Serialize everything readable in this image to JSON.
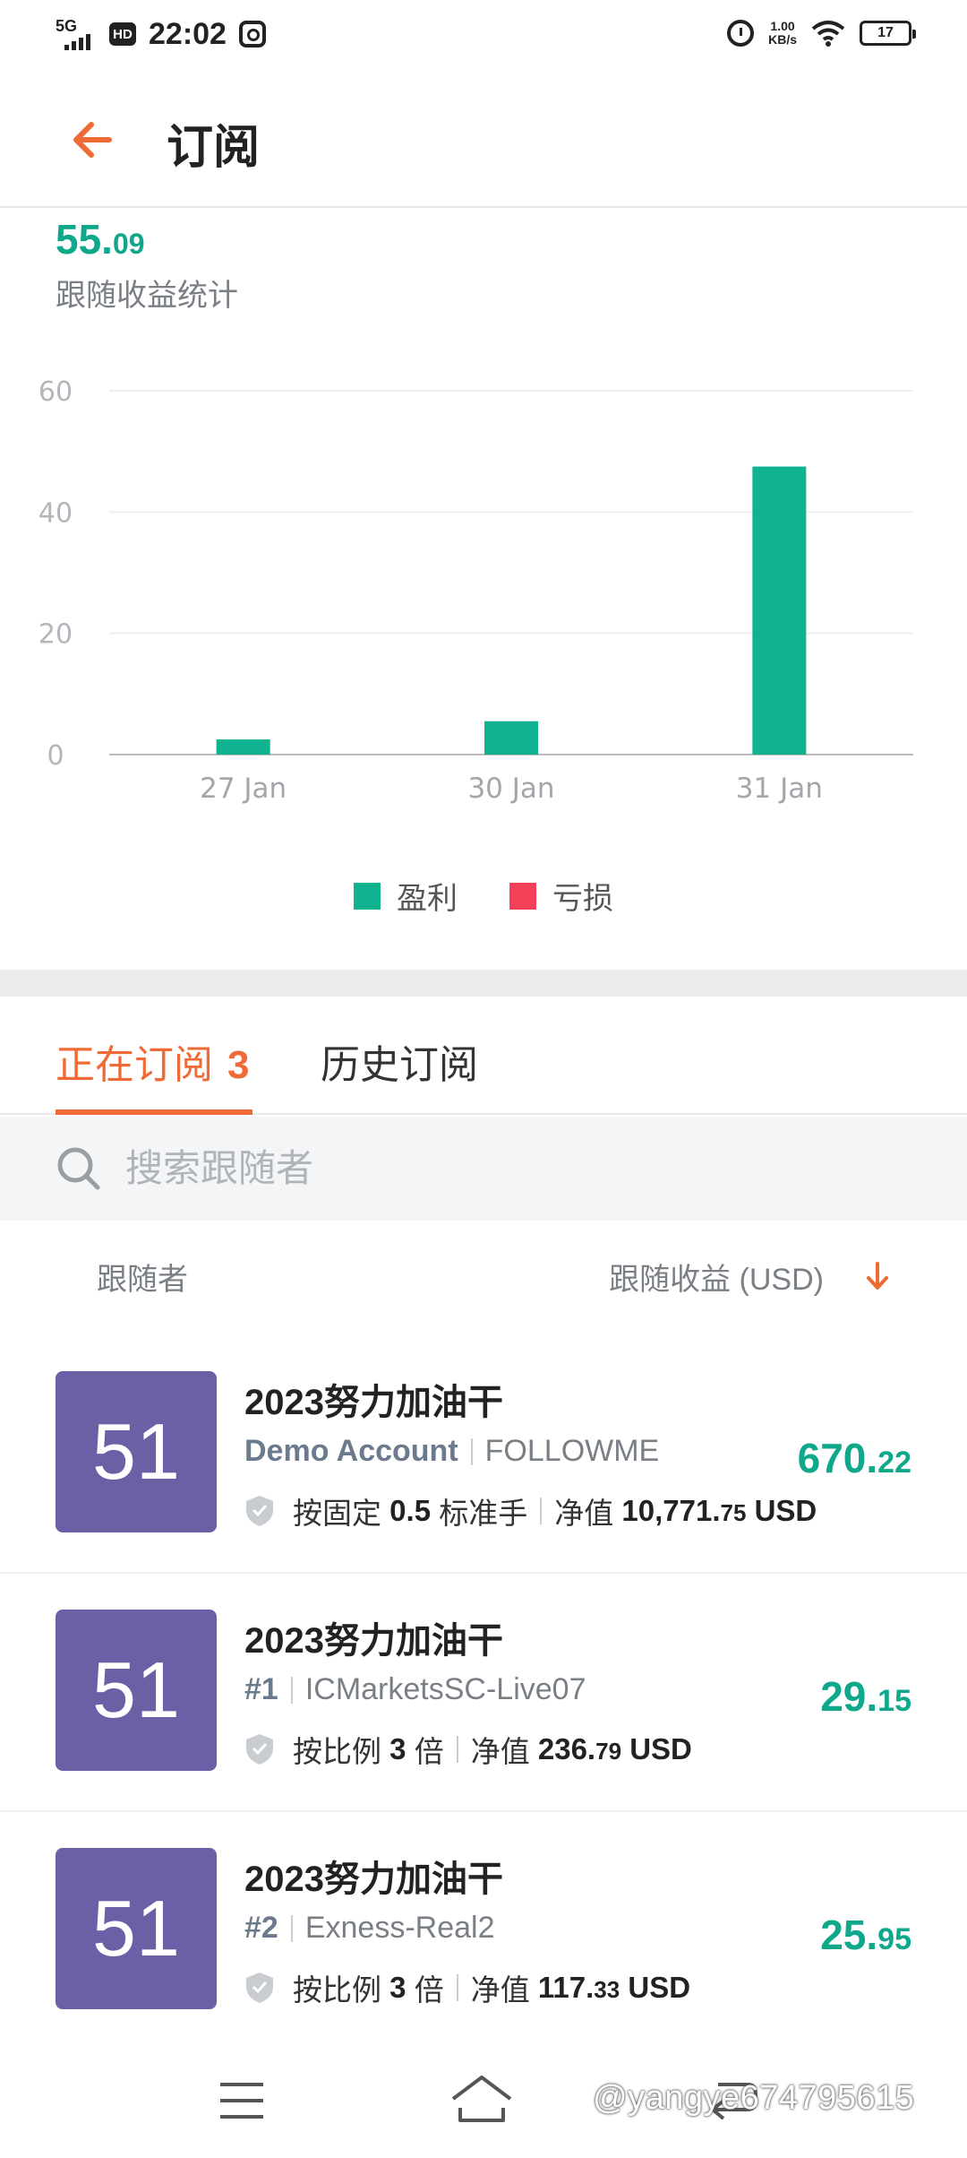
{
  "status_bar": {
    "network": "5G",
    "hd": "HD",
    "time": "22:02",
    "speed_value": "1.00",
    "speed_unit": "KB/s",
    "battery": "17"
  },
  "header": {
    "title": "订阅",
    "back_icon": "arrow-left-icon",
    "accent_color": "#f06a35"
  },
  "summary": {
    "value_int": "55.",
    "value_dec": "09",
    "label": "跟随收益统计"
  },
  "chart_data": {
    "type": "bar",
    "categories": [
      "27 Jan",
      "30 Jan",
      "31 Jan"
    ],
    "series": [
      {
        "name": "盈利",
        "color": "#0fb38f",
        "values": [
          2.5,
          5.5,
          47.5
        ]
      },
      {
        "name": "亏损",
        "color": "#f5405a",
        "values": [
          0,
          0,
          0
        ]
      }
    ],
    "y_ticks": [
      "0",
      "20",
      "40",
      "60"
    ],
    "ylim": [
      0,
      60
    ],
    "grid": true,
    "legend_position": "bottom-center"
  },
  "tabs": {
    "active_label": "正在订阅",
    "active_count": "3",
    "history_label": "历史订阅"
  },
  "search": {
    "placeholder": "搜索跟随者"
  },
  "columns": {
    "follower": "跟随者",
    "profit": "跟随收益 (USD)"
  },
  "rows": [
    {
      "avatar": "51",
      "name": "2023努力加油干",
      "account": "Demo Account",
      "server": "FOLLOWME",
      "mode_prefix": "按固定",
      "mode_value": "0.5",
      "mode_suffix": "标准手",
      "equity_label": "净值",
      "equity_int": "10,771.",
      "equity_dec": "75",
      "equity_unit": "USD",
      "profit_int": "670.",
      "profit_dec": "22"
    },
    {
      "avatar": "51",
      "name": "2023努力加油干",
      "account": "#1",
      "server": "ICMarketsSC-Live07",
      "mode_prefix": "按比例",
      "mode_value": "3",
      "mode_suffix": "倍",
      "equity_label": "净值",
      "equity_int": "236.",
      "equity_dec": "79",
      "equity_unit": "USD",
      "profit_int": "29.",
      "profit_dec": "15"
    },
    {
      "avatar": "51",
      "name": "2023努力加油干",
      "account": "#2",
      "server": "Exness-Real2",
      "mode_prefix": "按比例",
      "mode_value": "3",
      "mode_suffix": "倍",
      "equity_label": "净值",
      "equity_int": "117.",
      "equity_dec": "33",
      "equity_unit": "USD",
      "profit_int": "25.",
      "profit_dec": "95"
    }
  ],
  "watermark": "@yangye674795615"
}
